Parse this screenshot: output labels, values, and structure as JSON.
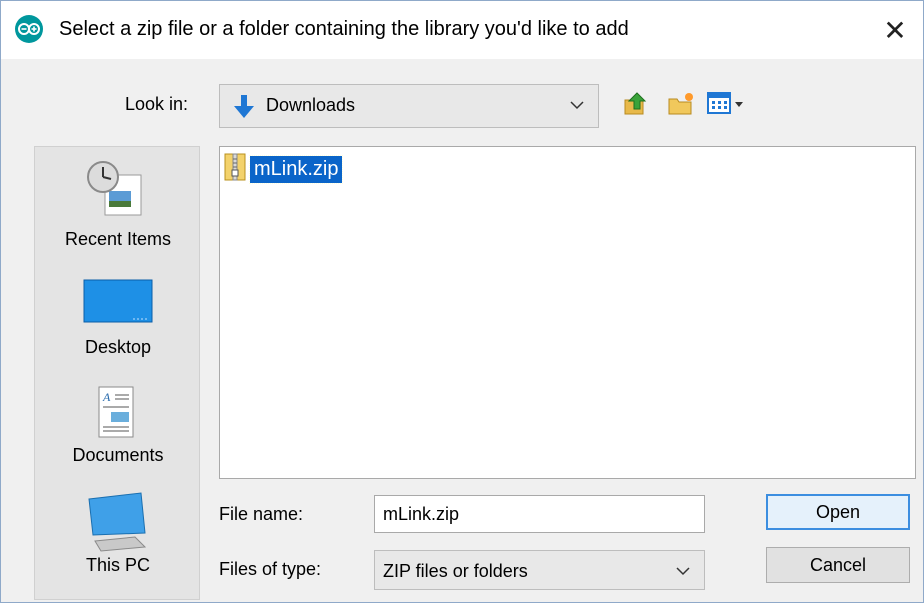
{
  "dialog": {
    "title": "Select a zip file or a folder containing the library you'd like to add",
    "close_label": "✕"
  },
  "lookin": {
    "label": "Look in:",
    "value": "Downloads"
  },
  "toolbar": {
    "icons": [
      "up-folder-icon",
      "new-folder-icon",
      "view-menu-icon"
    ]
  },
  "places": [
    {
      "label": "Recent Items",
      "icon": "recent-items-icon"
    },
    {
      "label": "Desktop",
      "icon": "desktop-icon"
    },
    {
      "label": "Documents",
      "icon": "documents-icon"
    },
    {
      "label": "This PC",
      "icon": "this-pc-icon"
    }
  ],
  "files": [
    {
      "name": "mLink.zip",
      "icon": "zip-folder-icon",
      "selected": true
    }
  ],
  "filename": {
    "label": "File name:",
    "value": "mLink.zip"
  },
  "filetype": {
    "label": "Files of type:",
    "value": "ZIP files or folders"
  },
  "buttons": {
    "open": "Open",
    "cancel": "Cancel"
  },
  "colors": {
    "selection": "#0a64c9",
    "arduino": "#00979d",
    "focus_border": "#3c8ee0"
  }
}
